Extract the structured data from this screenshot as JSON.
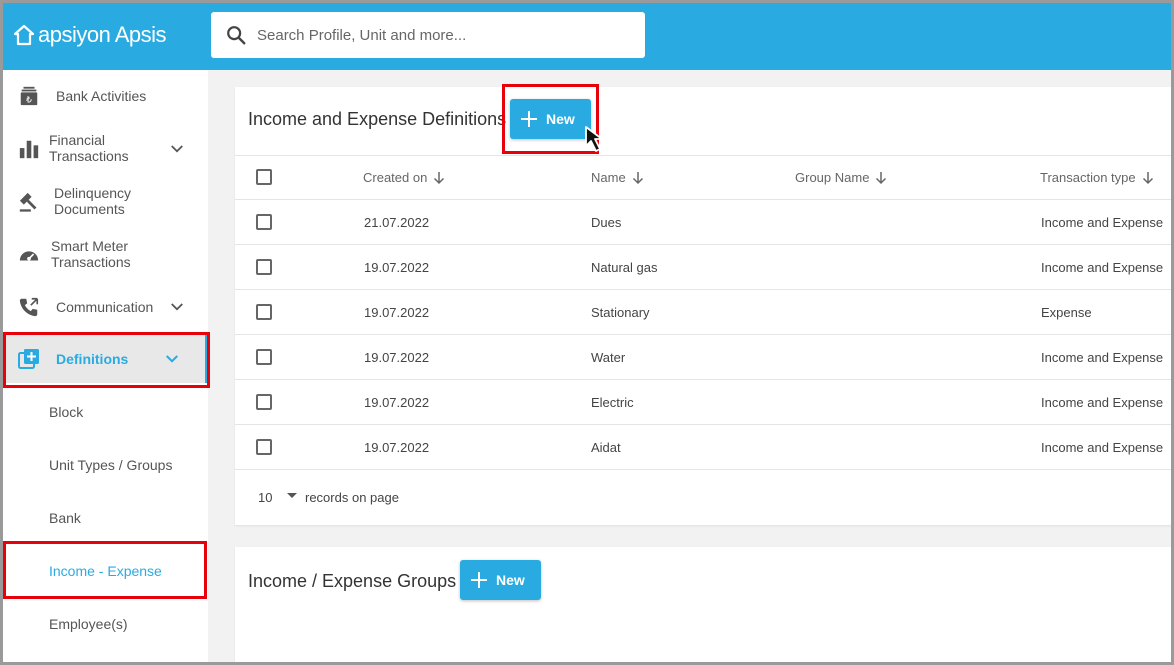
{
  "header": {
    "logo_text": "apsiyon Apsis",
    "search_placeholder": "Search Profile, Unit and more..."
  },
  "sidebar": {
    "items": [
      {
        "label": "Bank Activities",
        "icon": "bank-icon"
      },
      {
        "label_line1": "Financial",
        "label_line2": "Transactions",
        "icon": "bar-chart-icon",
        "has_chevron": true
      },
      {
        "label_line1": "Delinquency",
        "label_line2": "Documents",
        "icon": "gavel-icon"
      },
      {
        "label_line1": "Smart Meter",
        "label_line2": "Transactions",
        "icon": "meter-icon"
      },
      {
        "label": "Communication",
        "icon": "phone-icon",
        "has_chevron": true
      },
      {
        "label": "Definitions",
        "icon": "add-box-icon",
        "has_chevron": true,
        "active": true
      }
    ],
    "sub_items": [
      {
        "label": "Block"
      },
      {
        "label": "Unit Types / Groups"
      },
      {
        "label": "Bank"
      },
      {
        "label": "Income - Expense",
        "active": true
      },
      {
        "label": "Employee(s)"
      }
    ]
  },
  "definitions_card": {
    "title": "Income and Expense Definitions",
    "new_button": "New",
    "columns": [
      "Created on",
      "Name",
      "Group Name",
      "Transaction type"
    ],
    "rows": [
      {
        "created_on": "21.07.2022",
        "name": "Dues",
        "group_name": "",
        "transaction_type": "Income and Expense"
      },
      {
        "created_on": "19.07.2022",
        "name": "Natural gas",
        "group_name": "",
        "transaction_type": "Income and Expense"
      },
      {
        "created_on": "19.07.2022",
        "name": "Stationary",
        "group_name": "",
        "transaction_type": "Expense"
      },
      {
        "created_on": "19.07.2022",
        "name": "Water",
        "group_name": "",
        "transaction_type": "Income and Expense"
      },
      {
        "created_on": "19.07.2022",
        "name": "Electric",
        "group_name": "",
        "transaction_type": "Income and Expense"
      },
      {
        "created_on": "19.07.2022",
        "name": "Aidat",
        "group_name": "",
        "transaction_type": "Income and Expense"
      }
    ],
    "per_page": "10",
    "per_page_label": "records on page"
  },
  "groups_card": {
    "title": "Income / Expense Groups",
    "new_button": "New"
  },
  "colors": {
    "accent": "#29abe2",
    "highlight": "#e8000b"
  }
}
